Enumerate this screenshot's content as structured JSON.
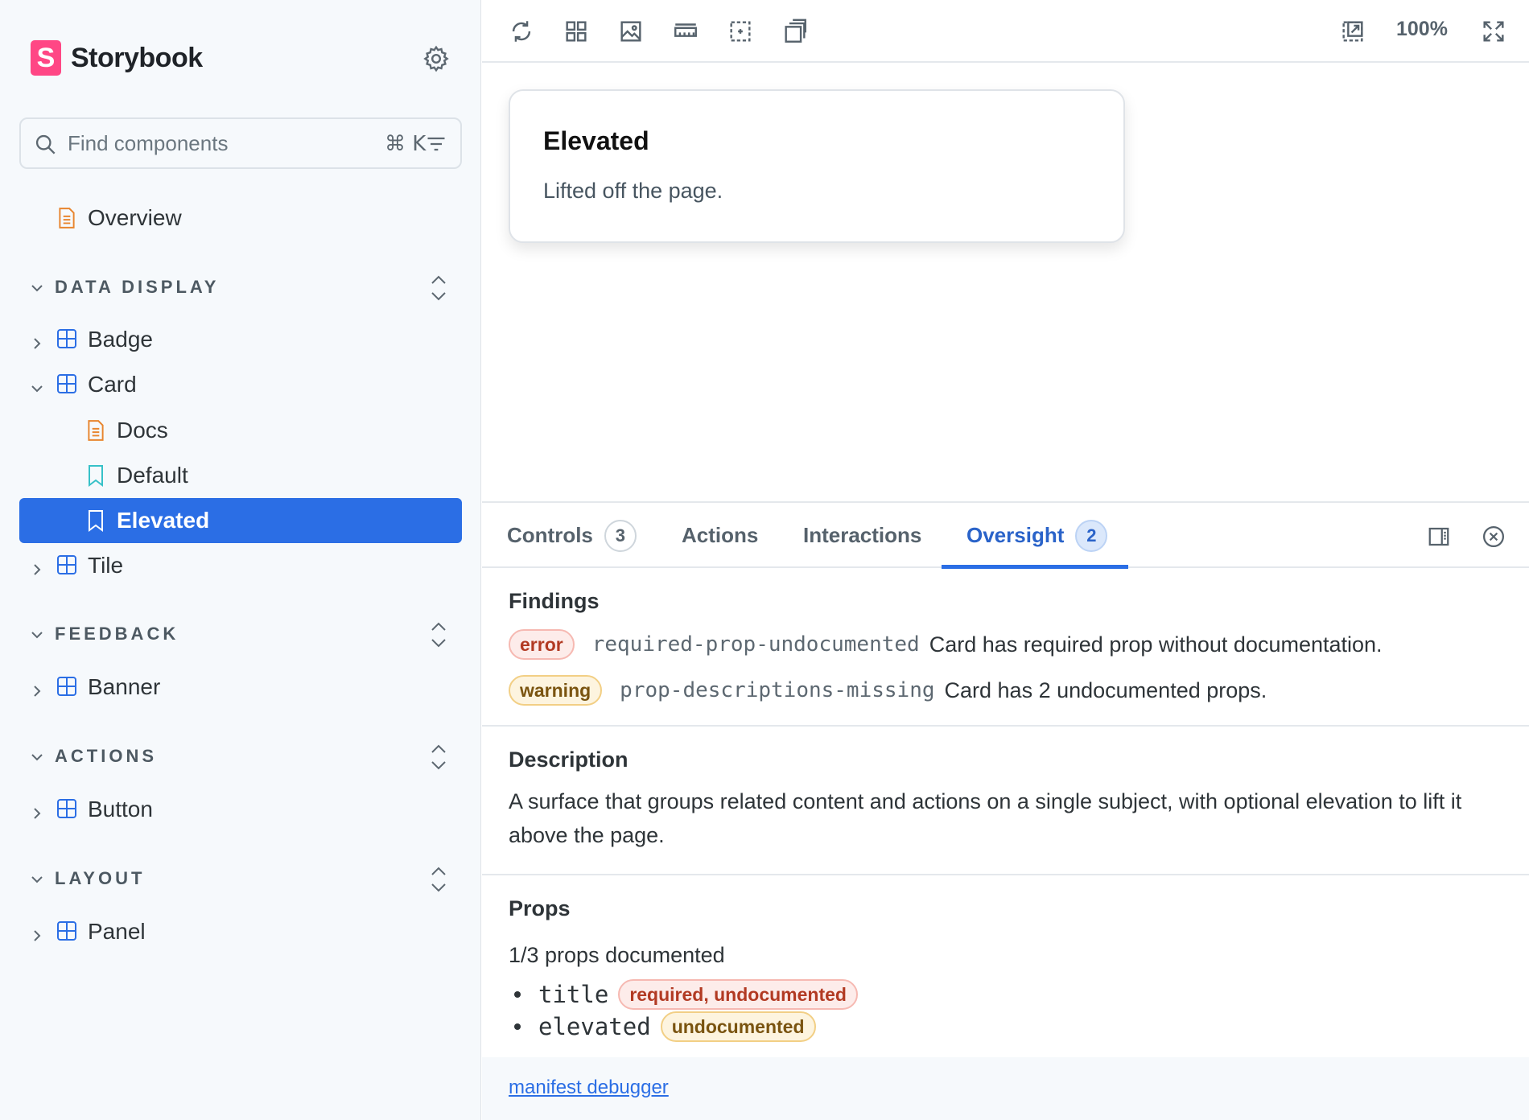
{
  "brand": {
    "name": "Storybook",
    "logo_letter": "S",
    "logo_color": "#ff4785"
  },
  "search": {
    "placeholder": "Find components",
    "shortcut": "⌘ K"
  },
  "sidebar": {
    "overview": "Overview",
    "sections": [
      {
        "label": "DATA DISPLAY"
      },
      {
        "label": "FEEDBACK"
      },
      {
        "label": "ACTIONS"
      },
      {
        "label": "LAYOUT"
      }
    ],
    "components": {
      "badge": "Badge",
      "card": "Card",
      "card_docs": "Docs",
      "card_default": "Default",
      "card_elevated": "Elevated",
      "tile": "Tile",
      "banner": "Banner",
      "button": "Button",
      "panel": "Panel"
    },
    "selected_color": "#2b6ee5"
  },
  "toolbar": {
    "zoom": "100%"
  },
  "preview": {
    "title": "Elevated",
    "text": "Lifted off the page."
  },
  "addons": {
    "tabs": [
      {
        "label": "Controls",
        "count": "3"
      },
      {
        "label": "Actions"
      },
      {
        "label": "Interactions"
      },
      {
        "label": "Oversight",
        "count": "2",
        "active": true
      }
    ],
    "findings": {
      "heading": "Findings",
      "items": [
        {
          "severity": "error",
          "rule": "required-prop-undocumented",
          "message": "Card has required prop without documentation."
        },
        {
          "severity": "warning",
          "rule": "prop-descriptions-missing",
          "message": "Card has 2 undocumented props."
        }
      ]
    },
    "description": {
      "heading": "Description",
      "text": "A surface that groups related content and actions on a single subject, with optional elevation to lift it above the page."
    },
    "props": {
      "heading": "Props",
      "summary": "1/3 props documented",
      "items": [
        {
          "name": "title",
          "tag": "required, undocumented"
        },
        {
          "name": "elevated",
          "tag": "undocumented"
        }
      ]
    },
    "footer_link": "manifest debugger"
  }
}
